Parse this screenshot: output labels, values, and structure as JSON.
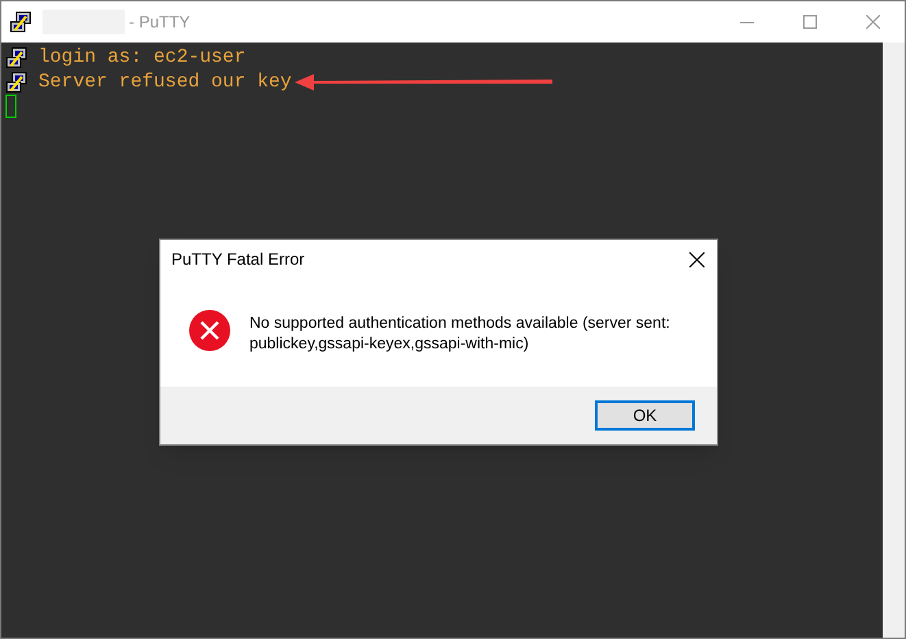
{
  "window": {
    "title": "- PuTTY"
  },
  "terminal": {
    "lines": [
      "login as: ec2-user",
      "Server refused our key"
    ]
  },
  "dialog": {
    "title": "PuTTY Fatal Error",
    "message": "No supported authentication methods available (server sent: publickey,gssapi-keyex,gssapi-with-mic)",
    "buttons": [
      "OK"
    ]
  }
}
